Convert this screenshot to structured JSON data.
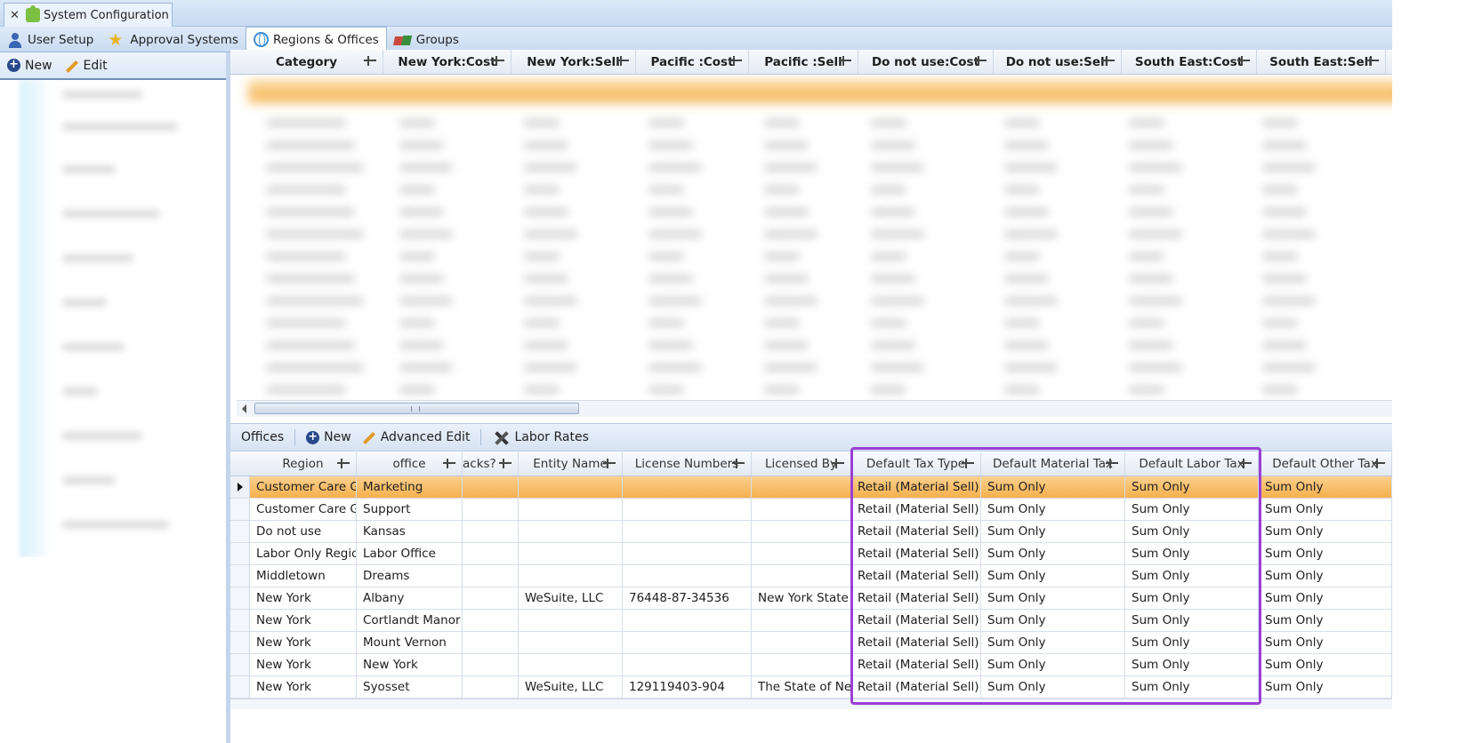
{
  "window_tab": {
    "close": "✕",
    "title": "System Configuration"
  },
  "subtabs": [
    {
      "label": "User Setup",
      "icon": "user-icon"
    },
    {
      "label": "Approval Systems",
      "icon": "star-icon"
    },
    {
      "label": "Regions & Offices",
      "icon": "globe-icon"
    },
    {
      "label": "Groups",
      "icon": "groups-icon"
    }
  ],
  "left_toolbar": {
    "new_label": "New",
    "edit_label": "Edit"
  },
  "top_grid": {
    "columns": [
      "Category",
      "New York:Cost",
      "New York:Sell",
      "Pacific :Cost",
      "Pacific :Sell",
      "Do not use:Cost",
      "Do not use:Sell",
      "South East:Cost",
      "South East:Sell"
    ]
  },
  "offices_toolbar": {
    "title": "Offices",
    "new_label": "New",
    "advanced_edit_label": "Advanced Edit",
    "labor_rates_label": "Labor Rates"
  },
  "offices_grid": {
    "columns": [
      "Region",
      "office",
      "acks?",
      "Entity Name",
      "License Numbers",
      "Licensed By",
      "Default Tax Type",
      "Default Material Tax",
      "Default Labor Tax",
      "Default Other Tax"
    ],
    "rows": [
      [
        "Customer Care Gr",
        "Marketing",
        "",
        "",
        "",
        "",
        "Retail (Material Sell)",
        "Sum Only",
        "Sum Only",
        "Sum Only"
      ],
      [
        "Customer Care Gr",
        "Support",
        "",
        "",
        "",
        "",
        "Retail (Material Sell)",
        "Sum Only",
        "Sum Only",
        "Sum Only"
      ],
      [
        "Do not use",
        "Kansas",
        "",
        "",
        "",
        "",
        "Retail (Material Sell)",
        "Sum Only",
        "Sum Only",
        "Sum Only"
      ],
      [
        "Labor Only Region",
        "Labor Office",
        "",
        "",
        "",
        "",
        "Retail (Material Sell)",
        "Sum Only",
        "Sum Only",
        "Sum Only"
      ],
      [
        "Middletown",
        "Dreams",
        "",
        "",
        "",
        "",
        "Retail (Material Sell)",
        "Sum Only",
        "Sum Only",
        "Sum Only"
      ],
      [
        "New York",
        "Albany",
        "",
        "WeSuite, LLC",
        "76448-87-34536",
        "New York State",
        "Retail (Material Sell)",
        "Sum Only",
        "Sum Only",
        "Sum Only"
      ],
      [
        "New York",
        "Cortlandt Manor",
        "",
        "",
        "",
        "",
        "Retail (Material Sell)",
        "Sum Only",
        "Sum Only",
        "Sum Only"
      ],
      [
        "New York",
        "Mount Vernon",
        "",
        "",
        "",
        "",
        "Retail (Material Sell)",
        "Sum Only",
        "Sum Only",
        "Sum Only"
      ],
      [
        "New York",
        "New York",
        "",
        "",
        "",
        "",
        "Retail (Material Sell)",
        "Sum Only",
        "Sum Only",
        "Sum Only"
      ],
      [
        "New York",
        "Syosset",
        "",
        "WeSuite, LLC",
        "129119403-904",
        "The State of New",
        "Retail (Material Sell)",
        "Sum Only",
        "Sum Only",
        "Sum Only"
      ]
    ]
  },
  "colors": {
    "selection": "#f5b04d",
    "highlight_box": "#9b3fd6"
  }
}
